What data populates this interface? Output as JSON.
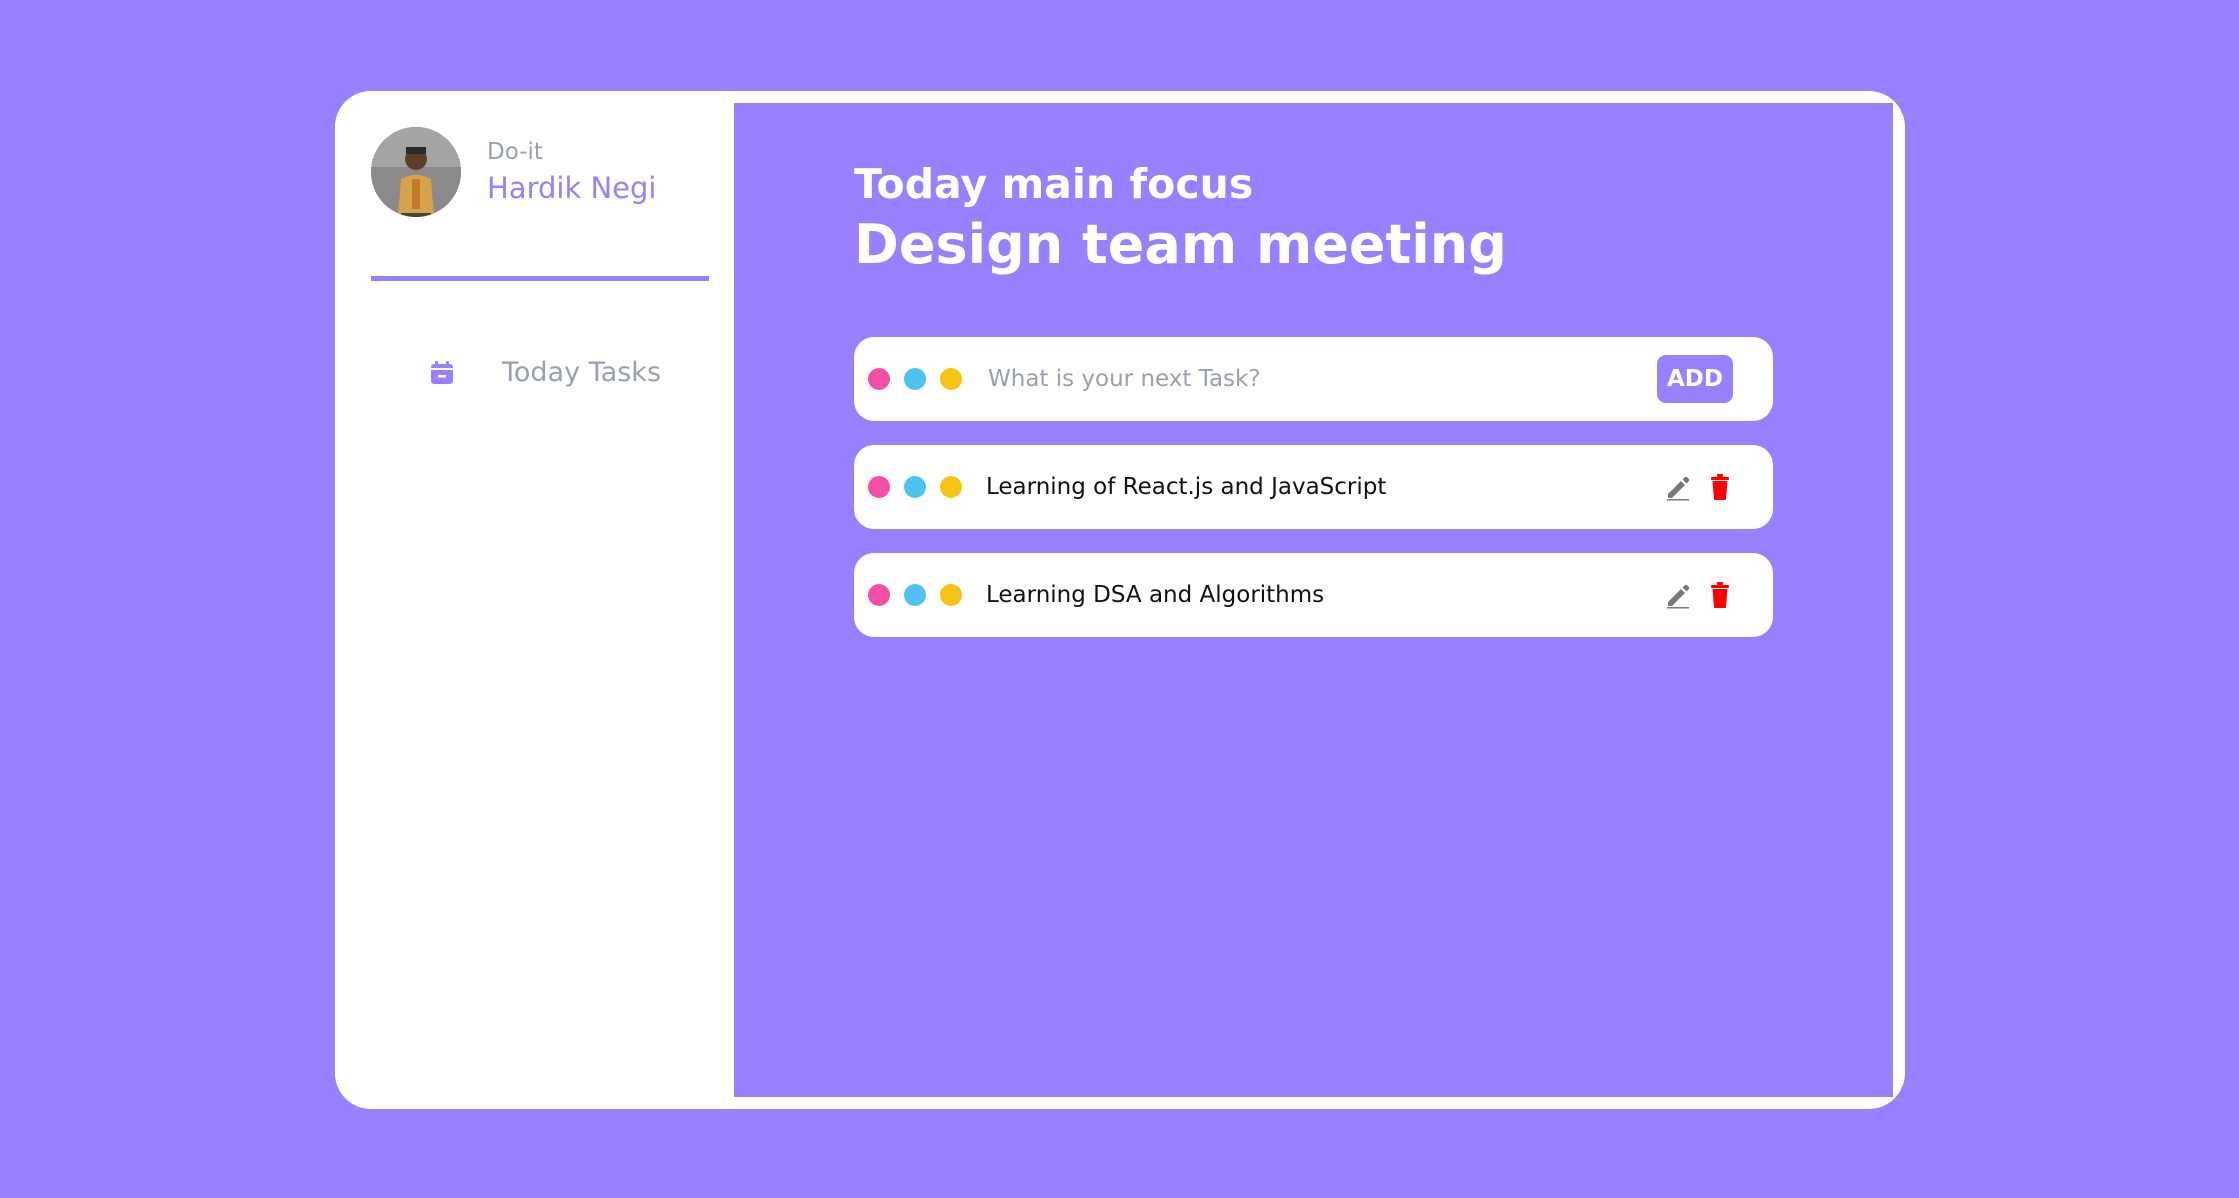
{
  "app": {
    "name": "Do-it",
    "user_name": "Hardik Negi"
  },
  "sidebar": {
    "items": [
      {
        "label": "Today Tasks",
        "icon": "calendar-icon"
      }
    ]
  },
  "focus": {
    "label": "Today main focus",
    "title": "Design team meeting"
  },
  "new_task": {
    "placeholder": "What is your next Task?",
    "value": "",
    "add_label": "ADD"
  },
  "tasks": [
    {
      "text": "Learning of React.js and JavaScript"
    },
    {
      "text": "Learning DSA and Algorithms"
    }
  ],
  "colors": {
    "accent": "#9880fe",
    "dot_pink": "#f44fa6",
    "dot_blue": "#4ec3ee",
    "dot_yellow": "#f6c414",
    "delete": "#ff0000",
    "edit": "#7a7a7a"
  },
  "icons": {
    "edit": "pencil-icon",
    "delete": "trash-icon",
    "nav": "calendar-icon"
  }
}
